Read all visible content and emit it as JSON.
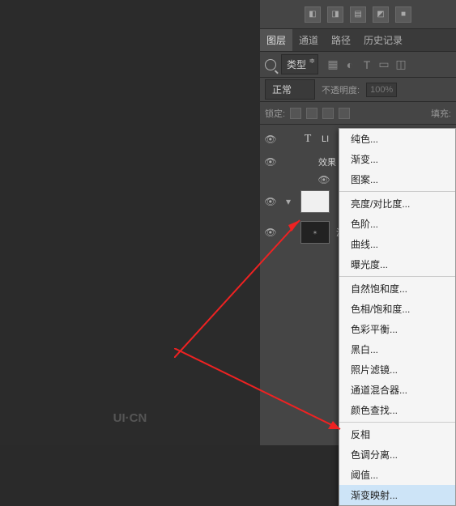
{
  "logo": "UI·CN",
  "tabs": [
    "图层",
    "通道",
    "路径",
    "历史记录"
  ],
  "active_tab": 0,
  "filter": {
    "type_label": "类型"
  },
  "blend": {
    "mode": "正常",
    "opacity_label": "不透明度:",
    "opacity_value": "100%"
  },
  "lock": {
    "label": "锁定:",
    "fill_label": "填充:"
  },
  "layers": [
    {
      "type": "text",
      "name": "LI"
    },
    {
      "type": "fx",
      "name": "效果"
    },
    {
      "type": "shape",
      "name": ""
    },
    {
      "type": "image",
      "name": "源"
    }
  ],
  "menu": {
    "groups": [
      [
        "纯色...",
        "渐变...",
        "图案..."
      ],
      [
        "亮度/对比度...",
        "色阶...",
        "曲线...",
        "曝光度..."
      ],
      [
        "自然饱和度...",
        "色相/饱和度...",
        "色彩平衡...",
        "黑白...",
        "照片滤镜...",
        "通道混合器...",
        "颜色查找..."
      ],
      [
        "反相",
        "色调分离...",
        "阈值...",
        "渐变映射..."
      ]
    ],
    "highlight": "渐变映射..."
  }
}
